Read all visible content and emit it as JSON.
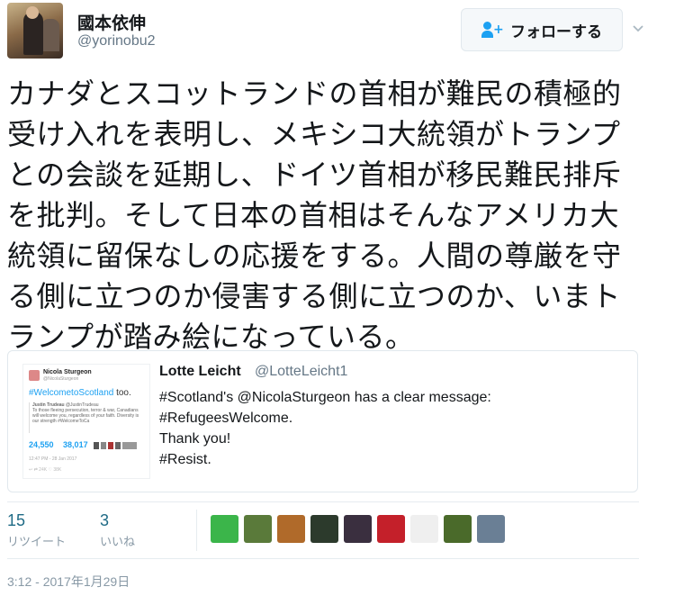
{
  "author": {
    "name": "國本依伸",
    "handle": "@yorinobu2"
  },
  "follow_button": {
    "label": "フォローする"
  },
  "tweet": {
    "lines": [
      "カナダとスコットランドの首相が難民の積極的",
      "受け入れを表明し、メキシコ大統領がトランプ",
      "との会談を延期し、ドイツ首相が移民難民排斥",
      "を批判。そして日本の首相はそんなアメリカ大",
      "統領に留保なしの応援をする。人間の尊厳を守",
      "る側に立つのか侵害する側に立つのか、いまト",
      "ランプが踏み絵になっている。"
    ]
  },
  "quoted": {
    "name": "Lotte Leicht",
    "handle": "@LotteLeicht1",
    "lines": [
      "#Scotland's @NicolaSturgeon has a clear message:",
      "#RefugeesWelcome.",
      "Thank you!",
      "#Resist."
    ],
    "thumb": {
      "author": "Nicola Sturgeon",
      "author_handle": "@NicolaSturgeon",
      "hashtag": "#WelcometoScotland",
      "hashtag_suffix": "too.",
      "embedded_author": "Justin Trudeau",
      "embedded_handle": "@JustinTrudeau",
      "embedded_text": "To those fleeing persecution, terror & war, Canadians will welcome you, regardless of your faith. Diversity is our strength #WelcomeToCa",
      "retweets": "24,550",
      "likes": "38,017",
      "date": "12:47 PM - 28 Jan 2017",
      "actions": "↩  ⇄ 24K  ♡ 38K"
    }
  },
  "stats": {
    "retweets": {
      "count": "15",
      "label": "リツイート"
    },
    "likes": {
      "count": "3",
      "label": "いいね"
    }
  },
  "likers": [
    {
      "color": "#3bb54a"
    },
    {
      "color": "#5a7a3a"
    },
    {
      "color": "#b06a2a"
    },
    {
      "color": "#2c3a2c"
    },
    {
      "color": "#3a2f3f"
    },
    {
      "color": "#c4202a"
    },
    {
      "color": "#efefef"
    },
    {
      "color": "#4a6a2a"
    },
    {
      "color": "#6a7f95"
    }
  ],
  "timestamp": "3:12 - 2017年1月29日",
  "colors": {
    "link": "#1da1f2",
    "stat_number": "#1f6b86",
    "secondary_text": "#8899a6"
  }
}
